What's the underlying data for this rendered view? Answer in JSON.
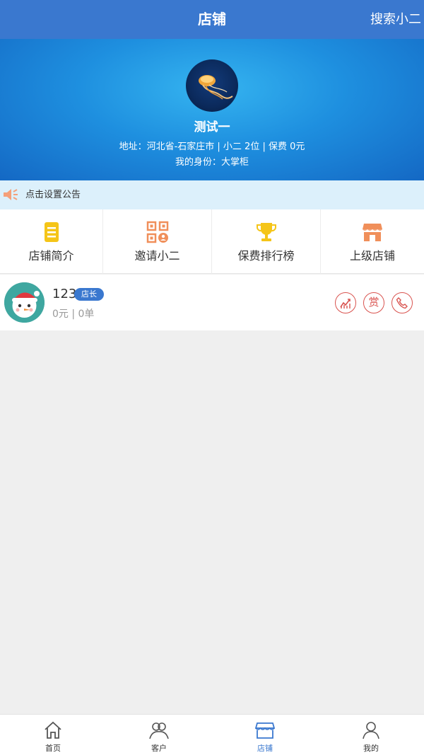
{
  "header": {
    "title": "店铺",
    "action": "搜索小二"
  },
  "shop": {
    "name": "测试一",
    "info": "地址：河北省-石家庄市 | 小二  2位 | 保费 0元",
    "role": "我的身份：大掌柜"
  },
  "notice": {
    "text": "点击设置公告"
  },
  "menu": {
    "items": [
      {
        "label": "店铺简介",
        "icon": "document-icon"
      },
      {
        "label": "邀请小二",
        "icon": "qr-code-icon"
      },
      {
        "label": "保费排行榜",
        "icon": "trophy-icon"
      },
      {
        "label": "上级店铺",
        "icon": "store-icon"
      }
    ]
  },
  "member": {
    "name": "123",
    "badge": "店长",
    "stats": "0元 | 0单",
    "actions": {
      "chart": "chart-icon",
      "reward": "赏",
      "phone": "phone-icon"
    }
  },
  "tabbar": {
    "items": [
      {
        "label": "首页",
        "icon": "home-icon"
      },
      {
        "label": "客户",
        "icon": "customers-icon"
      },
      {
        "label": "店铺",
        "icon": "shop-icon"
      },
      {
        "label": "我的",
        "icon": "user-icon"
      }
    ],
    "active_index": 2
  },
  "colors": {
    "primary": "#3a78cf",
    "notice_bg": "#dcf0fb",
    "action_red": "#d9534f",
    "menu_yellow": "#f5c518",
    "menu_orange": "#f08f5a"
  }
}
